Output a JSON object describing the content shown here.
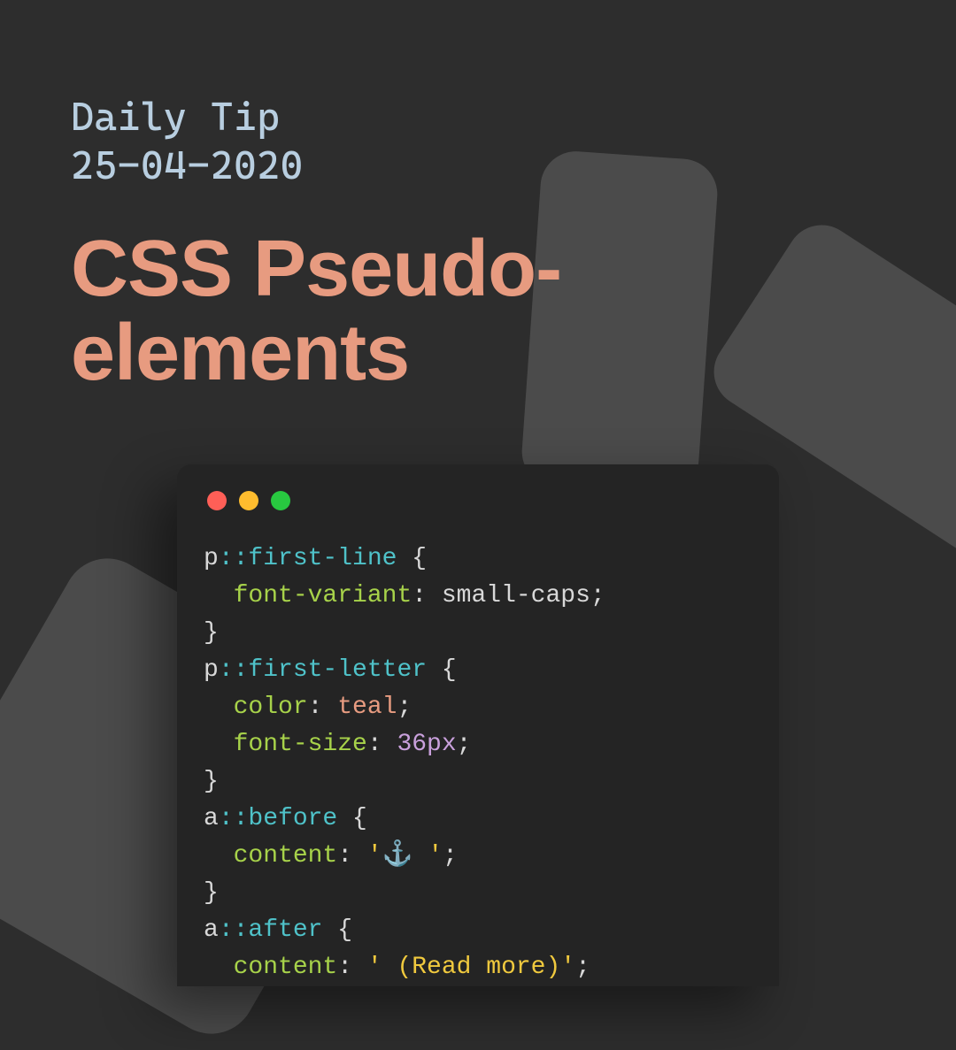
{
  "header": {
    "kicker_line1": "Daily Tip",
    "kicker_line2": "25-04-2020",
    "title_line1": "CSS Pseudo-",
    "title_line2": "elements"
  },
  "editor": {
    "dots": [
      "red",
      "yellow",
      "green"
    ]
  },
  "code": {
    "r1_sel": "p",
    "r1_pseudo": "::first-line",
    "r1_open": " {",
    "r2_indent": "  ",
    "r2_prop": "font-variant",
    "r2_colon": ": ",
    "r2_val": "small-caps",
    "r2_semi": ";",
    "r3_close": "}",
    "r4_sel": "p",
    "r4_pseudo": "::first-letter",
    "r4_open": " {",
    "r5_indent": "  ",
    "r5_prop": "color",
    "r5_colon": ": ",
    "r5_val": "teal",
    "r5_semi": ";",
    "r6_indent": "  ",
    "r6_prop": "font-size",
    "r6_colon": ": ",
    "r6_val": "36px",
    "r6_semi": ";",
    "r7_close": "}",
    "r8_sel": "a",
    "r8_pseudo": "::before",
    "r8_open": " {",
    "r9_indent": "  ",
    "r9_prop": "content",
    "r9_colon": ": ",
    "r9_val": "'⚓ '",
    "r9_semi": ";",
    "r10_close": "}",
    "r11_sel": "a",
    "r11_pseudo": "::after",
    "r11_open": " {",
    "r12_indent": "  ",
    "r12_prop": "content",
    "r12_colon": ": ",
    "r12_val": "' (Read more)'",
    "r12_semi": ";"
  }
}
